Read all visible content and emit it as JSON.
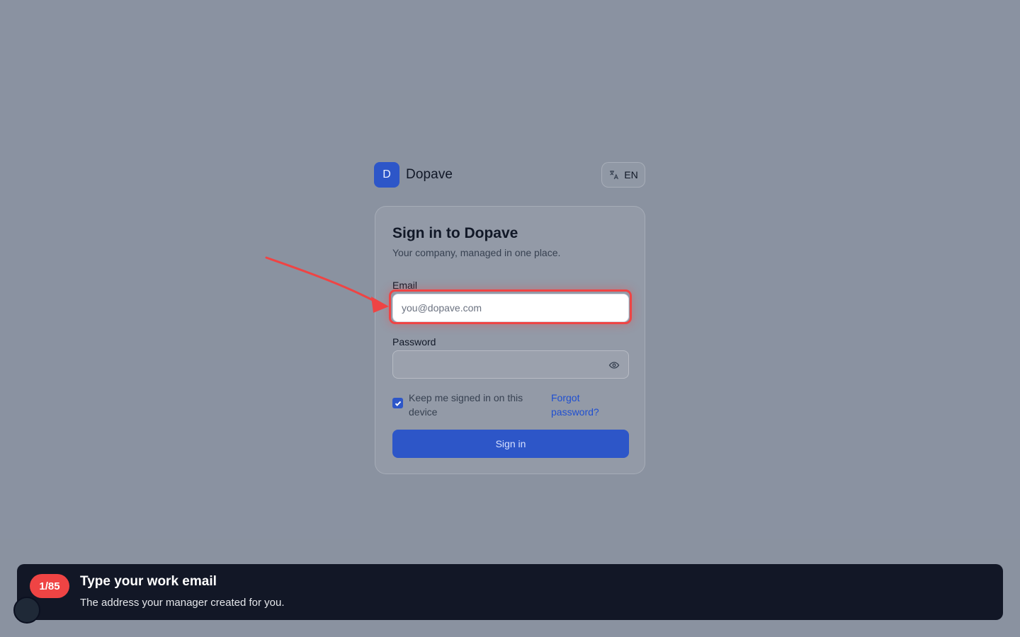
{
  "brand": {
    "logo_letter": "D",
    "name": "Dopave"
  },
  "language": {
    "code": "EN",
    "icon": "translate-icon"
  },
  "login": {
    "title": "Sign in to Dopave",
    "subtitle": "Your company, managed in one place.",
    "email_label": "Email",
    "email_placeholder": "you@dopave.com",
    "email_value": "",
    "password_label": "Password",
    "password_value": "",
    "password_icon": "eye-icon",
    "keep_signed_in_label": "Keep me signed in on this device",
    "keep_signed_in_checked": true,
    "forgot_password": "Forgot password?",
    "signin_button": "Sign in"
  },
  "guide": {
    "step_badge": "1/85",
    "title": "Type your work email",
    "subtitle": "The address your manager created for you."
  },
  "colors": {
    "primary": "#2d56c8",
    "highlight": "#ef4444",
    "guide_background": "#121726"
  }
}
